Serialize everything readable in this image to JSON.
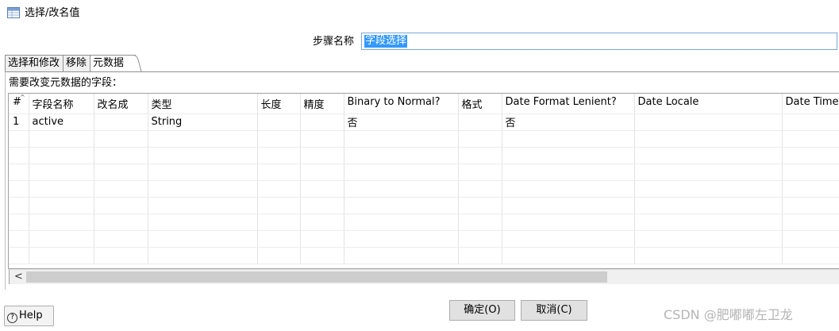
{
  "window": {
    "title": "选择/改名值",
    "icon": "transform-grid-icon"
  },
  "step": {
    "label": "步骤名称",
    "value": "字段选择"
  },
  "tabs": [
    {
      "label": "选择和修改",
      "active": false
    },
    {
      "label": "移除",
      "active": false
    },
    {
      "label": "元数据",
      "active": true
    }
  ],
  "panel": {
    "caption": "需要改变元数据的字段："
  },
  "table": {
    "sort_indicator": "^",
    "columns": [
      "#",
      "字段名称",
      "改名成",
      "类型",
      "长度",
      "精度",
      "Binary to Normal?",
      "格式",
      "Date Format Lenient?",
      "Date Locale",
      "Date Time"
    ],
    "rows": [
      [
        "1",
        "active",
        "",
        "String",
        "",
        "",
        "否",
        "",
        "否",
        "",
        ""
      ]
    ]
  },
  "scrollbar": {
    "left_arrow": "<"
  },
  "buttons": {
    "help": "Help",
    "ok": "确定(O)",
    "cancel": "取消(C)"
  },
  "watermark": "CSDN @肥嘟嘟左卫龙",
  "colors": {
    "selection": "#3399ff",
    "border": "#8f8f8f",
    "button_bg": "#e1e1e1"
  }
}
